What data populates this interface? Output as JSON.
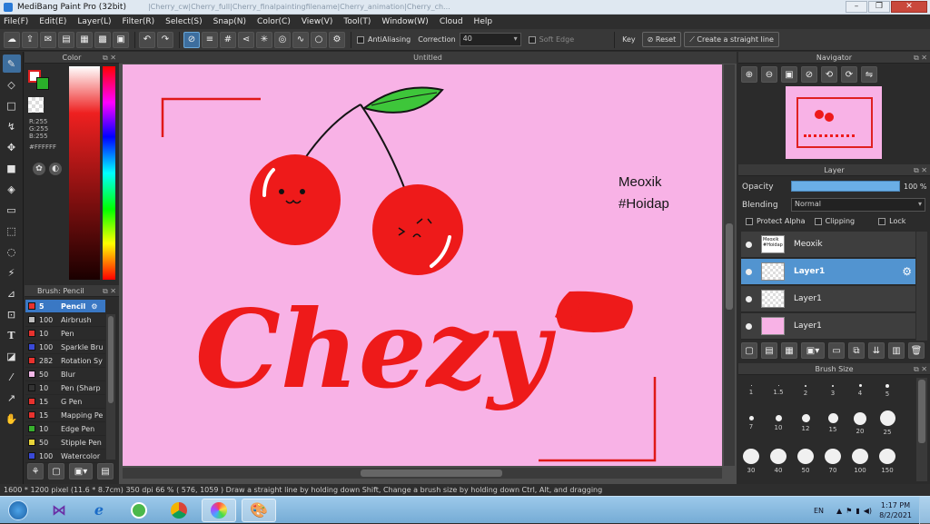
{
  "window": {
    "title": "MediBang Paint Pro (32bit)",
    "background_tabs": "|Cherry_cw|Cherry_full|Cherry_finalpaintingfilename|Cherry_animation|Cherry_ch..."
  },
  "menu": [
    "File(F)",
    "Edit(E)",
    "Layer(L)",
    "Filter(R)",
    "Select(S)",
    "Snap(N)",
    "Color(C)",
    "View(V)",
    "Tool(T)",
    "Window(W)",
    "Cloud",
    "Help"
  ],
  "toolbar": {
    "antialiasing_label": "AntiAliasing",
    "correction_label": "Correction",
    "correction_value": "40",
    "soft_edge_label": "Soft Edge",
    "key_label": "Key",
    "reset_label": "Reset",
    "straight_line_label": "Create a straight line"
  },
  "color_panel": {
    "title": "Color",
    "r": "R:255",
    "g": "G:255",
    "b": "B:255",
    "hex": "#FFFFFF"
  },
  "brush_panel": {
    "title": "Brush: Pencil",
    "items": [
      {
        "size": "5",
        "name": "Pencil",
        "color": "#e8322e"
      },
      {
        "size": "100",
        "name": "Airbrush",
        "color": "#bdbdbd"
      },
      {
        "size": "10",
        "name": "Pen",
        "color": "#e8322e"
      },
      {
        "size": "100",
        "name": "Sparkle Bru",
        "color": "#3a4ad8"
      },
      {
        "size": "282",
        "name": "Rotation Sy",
        "color": "#e8322e"
      },
      {
        "size": "50",
        "name": "Blur",
        "color": "#f2b8e8"
      },
      {
        "size": "10",
        "name": "Pen (Sharp",
        "color": "#333333"
      },
      {
        "size": "15",
        "name": "G Pen",
        "color": "#e8322e"
      },
      {
        "size": "15",
        "name": "Mapping Pe",
        "color": "#e8322e"
      },
      {
        "size": "10",
        "name": "Edge Pen",
        "color": "#38b02e"
      },
      {
        "size": "50",
        "name": "Stipple Pen",
        "color": "#e8d43a"
      },
      {
        "size": "100",
        "name": "Watercolor",
        "color": "#3a4ad8"
      }
    ]
  },
  "canvas": {
    "tab_title": "Untitled",
    "text_line1": "Meoxik",
    "text_line2": "#Hoidap",
    "lettering": "Chezy"
  },
  "navigator": {
    "title": "Navigator"
  },
  "layer_panel": {
    "title": "Layer",
    "opacity_label": "Opacity",
    "opacity_value": "100 %",
    "blending_label": "Blending",
    "blending_value": "Normal",
    "protect_alpha": "Protect Alpha",
    "clipping": "Clipping",
    "lock": "Lock",
    "layers": [
      {
        "name": "Meoxik",
        "selected": false
      },
      {
        "name": "Layer1",
        "selected": true
      },
      {
        "name": "Layer1",
        "selected": false
      },
      {
        "name": "Layer1",
        "selected": false
      }
    ]
  },
  "brush_size": {
    "title": "Brush Size",
    "sizes": [
      "1",
      "1.5",
      "2",
      "3",
      "4",
      "5",
      "7",
      "10",
      "12",
      "15",
      "20",
      "25",
      "30",
      "40",
      "50",
      "70",
      "100",
      "150"
    ]
  },
  "status": {
    "size": "1600 * 1200 pixel",
    "physical": "(11.6 * 8.7cm)",
    "dpi": "350 dpi",
    "zoom": "66 %",
    "coords": "( 576, 1059 )",
    "hint": "Draw a straight line by holding down Shift, Change a brush size by holding down Ctrl, Alt, and dragging"
  },
  "taskbar": {
    "lang": "EN",
    "time": "1:17 PM",
    "date": "8/2/2021"
  }
}
